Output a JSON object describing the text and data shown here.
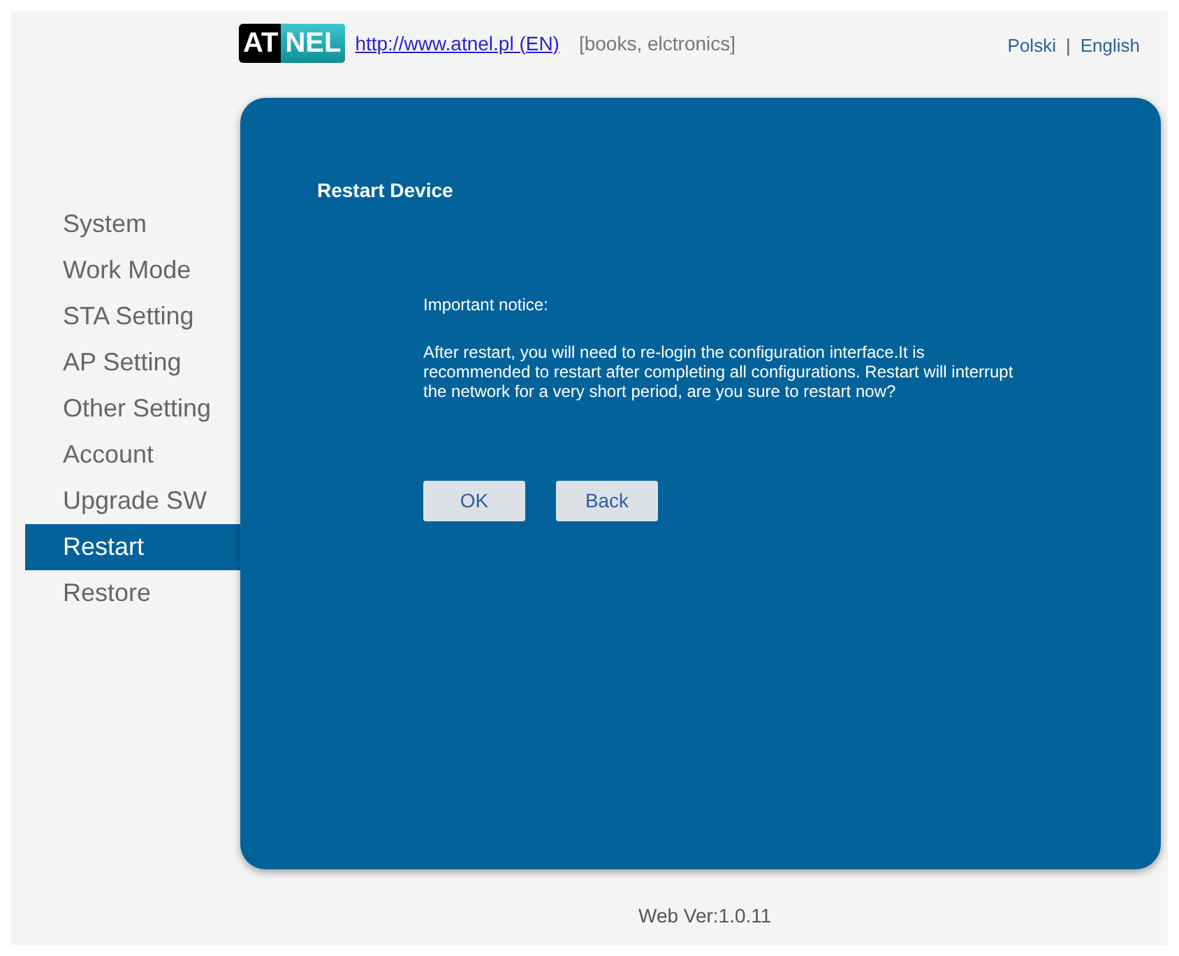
{
  "header": {
    "logo": {
      "part_1": "AT",
      "part_2": "NEL"
    },
    "link": "http://www.atnel.pl (EN)",
    "tagline": "[books, elctronics]",
    "languages": [
      {
        "label": "Polski"
      },
      {
        "label": "English"
      }
    ],
    "separator": "|"
  },
  "sidebar": {
    "items": [
      {
        "label": "System",
        "selected": false
      },
      {
        "label": "Work Mode",
        "selected": false
      },
      {
        "label": "STA Setting",
        "selected": false
      },
      {
        "label": "AP Setting",
        "selected": false
      },
      {
        "label": "Other Setting",
        "selected": false
      },
      {
        "label": "Account",
        "selected": false
      },
      {
        "label": "Upgrade SW",
        "selected": false
      },
      {
        "label": "Restart",
        "selected": true
      },
      {
        "label": "Restore",
        "selected": false
      }
    ]
  },
  "panel": {
    "title": "Restart Device",
    "notice_heading": "Important notice:",
    "notice_text": "After restart, you will need to re-login the configuration interface.It is recommended to restart after completing all configurations. Restart will interrupt the network for a very short period, are you sure to restart now?",
    "buttons": [
      {
        "label": "OK"
      },
      {
        "label": "Back"
      }
    ]
  },
  "footer": "Web Ver:1.0.11"
}
